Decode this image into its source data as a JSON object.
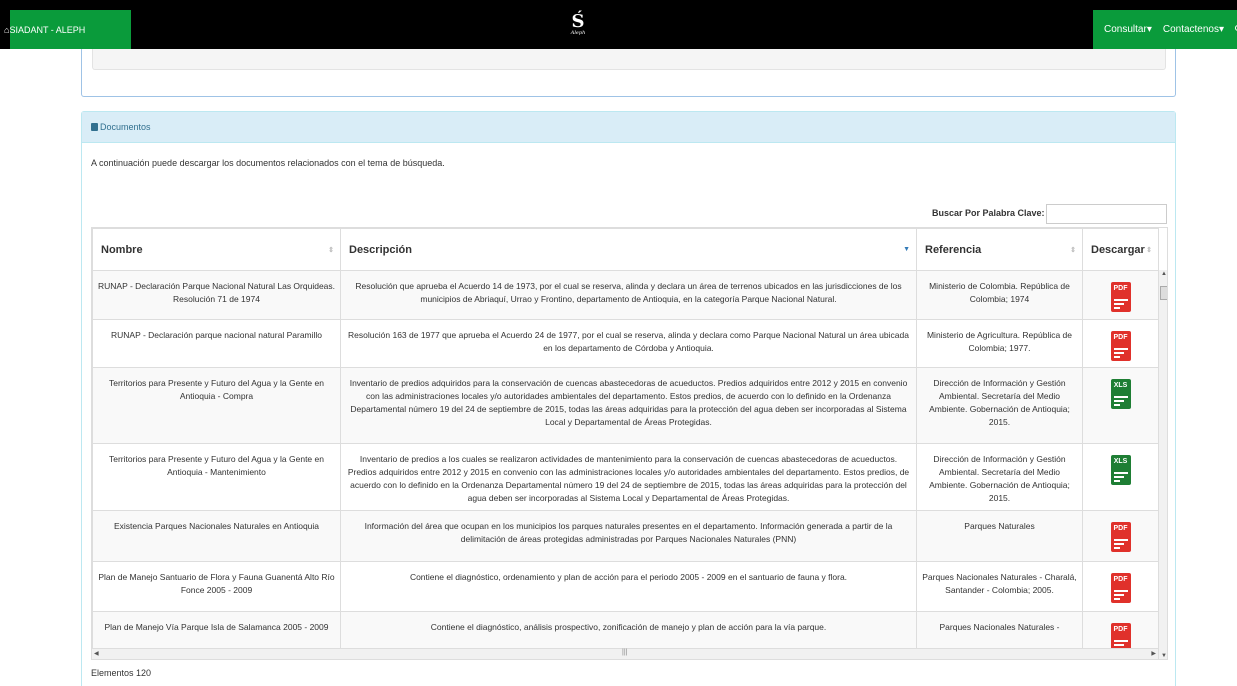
{
  "navbar": {
    "brand": "SIADANT - ALEPH",
    "logo_mark": "Ś",
    "logo_sub": "Aleph",
    "menu": [
      "Consultar",
      "Contactenos"
    ]
  },
  "documents": {
    "heading": "Documentos",
    "intro": "A continuación puede descargar los documentos relacionados con el tema de búsqueda.",
    "search_label": "Buscar Por Palabra Clave:",
    "search_value": "",
    "columns": [
      "Nombre",
      "Descripción",
      "Referencia",
      "Descargar"
    ],
    "rows": [
      {
        "nombre": "RUNAP - Declaración Parque Nacional Natural Las Orquideas. Resolución 71 de 1974",
        "descripcion": "Resolución que aprueba el Acuerdo 14 de 1973, por el cual se reserva, alinda y declara un área de terrenos ubicados en las jurisdicciones de los municipios de Abriaquí, Urrao y Frontino, departamento de Antioquia, en la categoría Parque Nacional Natural.",
        "referencia": "Ministerio de Colombia. República de Colombia; 1974",
        "tipo": "PDF"
      },
      {
        "nombre": "RUNAP - Declaración parque nacional natural Paramillo",
        "descripcion": "Resolución 163 de 1977 que aprueba el Acuerdo 24 de 1977, por el cual se reserva, alinda y declara como Parque Nacional Natural un área ubicada en los departamento de Córdoba y Antioquia.",
        "referencia": "Ministerio de Agricultura. República de Colombia; 1977.",
        "tipo": "PDF"
      },
      {
        "nombre": "Territorios para Presente y Futuro del Agua y la Gente en Antioquia - Compra",
        "descripcion": "Inventario de predios adquiridos para la conservación de cuencas abastecedoras de acueductos. Predios adquiridos entre 2012 y 2015 en convenio con las administraciones locales y/o autoridades ambientales del departamento. Estos predios, de acuerdo con lo definido en la Ordenanza Departamental número 19 del 24 de septiembre de 2015, todas las áreas adquiridas para la protección del agua deben ser incorporadas al Sistema Local y Departamental de Áreas Protegidas.",
        "referencia": "Dirección de Información y Gestión Ambiental. Secretaría del Medio Ambiente. Gobernación de Antioquia; 2015.",
        "tipo": "XLS"
      },
      {
        "nombre": "Territorios para Presente y Futuro del Agua y la Gente en Antioquia - Mantenimiento",
        "descripcion": "Inventario de predios a los cuales se realizaron actividades de mantenimiento para la conservación de cuencas abastecedoras de acueductos. Predios adquiridos entre 2012 y 2015 en convenio con las administraciones locales y/o autoridades ambientales del departamento. Estos predios, de acuerdo con lo definido en la Ordenanza Departamental número 19 del 24 de septiembre de 2015, todas las áreas adquiridas para la protección del agua deben ser incorporadas al Sistema Local y Departamental de Áreas Protegidas.",
        "referencia": "Dirección de Información y Gestión Ambiental. Secretaría del Medio Ambiente. Gobernación de Antioquia; 2015.",
        "tipo": "XLS"
      },
      {
        "nombre": "Existencia Parques Nacionales Naturales en Antioquia",
        "descripcion": "Información del área que ocupan en los municipios los parques naturales presentes en el departamento. Información generada a partir de la delimitación de áreas protegidas administradas por Parques Nacionales Naturales (PNN)",
        "referencia": "Parques Naturales",
        "tipo": "PDF"
      },
      {
        "nombre": "Plan de Manejo Santuario de Flora y Fauna Guanentá Alto Río Fonce 2005 - 2009",
        "descripcion": "Contiene el diagnóstico, ordenamiento y plan de acción para el periodo 2005 - 2009 en el santuario de fauna y flora.",
        "referencia": "Parques Nacionales Naturales - Charalá, Santander - Colombia; 2005.",
        "tipo": "PDF"
      },
      {
        "nombre": "Plan de Manejo Vía Parque Isla de Salamanca 2005 - 2009",
        "descripcion": "Contiene el diagnóstico, análisis prospectivo, zonificación de manejo y plan de acción para la vía parque.",
        "referencia": "Parques Nacionales Naturales -",
        "tipo": "PDF"
      }
    ],
    "footer": "Elementos 120"
  },
  "colors": {
    "navbar": "#000000",
    "accent_green": "#0a9b3b",
    "panel_heading": "#d9edf7",
    "pdf": "#e0312b",
    "xls": "#1e7e34"
  }
}
